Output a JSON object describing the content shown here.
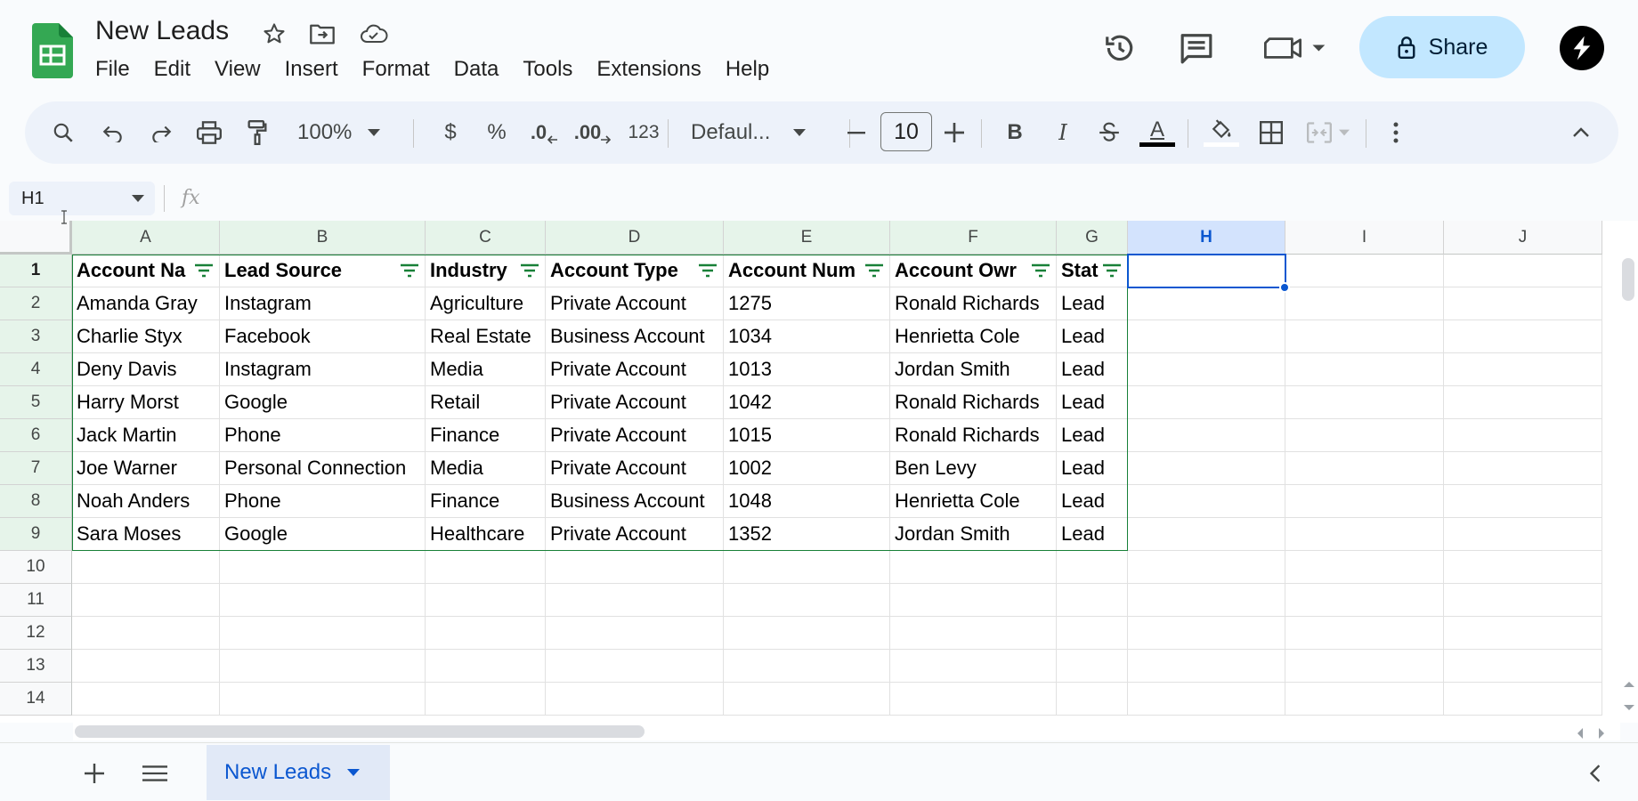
{
  "app": {
    "title": "New Leads",
    "menu": [
      "File",
      "Edit",
      "View",
      "Insert",
      "Format",
      "Data",
      "Tools",
      "Extensions",
      "Help"
    ],
    "share_label": "Share",
    "icons": {
      "star": "star-icon",
      "move": "move-to-folder-icon",
      "cloud": "cloud-saved-icon",
      "history": "version-history-icon",
      "comments": "comments-icon",
      "meet": "meet-icon"
    }
  },
  "toolbar": {
    "zoom": "100%",
    "currency": "$",
    "percent": "%",
    "decrease_decimal": ".0",
    "increase_decimal": ".00",
    "number_format": "123",
    "font": "Defaul...",
    "font_size": "10",
    "bold": "B",
    "italic": "I",
    "text_color_letter": "A",
    "text_color": "#000000"
  },
  "formula_bar": {
    "cell_ref": "H1",
    "fx": "fx",
    "value": ""
  },
  "sheet": {
    "columns": [
      "A",
      "B",
      "C",
      "D",
      "E",
      "F",
      "G",
      "H",
      "I",
      "J"
    ],
    "rows": [
      "1",
      "2",
      "3",
      "4",
      "5",
      "6",
      "7",
      "8",
      "9",
      "10",
      "11",
      "12",
      "13",
      "14"
    ],
    "header": [
      "Account Na",
      "Lead Source",
      "Industry",
      "Account Type",
      "Account Num",
      "Account Owr",
      "Stat"
    ],
    "data": [
      [
        "Amanda Gray",
        "Instagram",
        "Agriculture",
        "Private Account",
        "1275",
        "Ronald Richards",
        "Lead"
      ],
      [
        "Charlie Styx",
        "Facebook",
        "Real Estate",
        "Business Account",
        "1034",
        "Henrietta Cole",
        "Lead"
      ],
      [
        "Deny Davis",
        "Instagram",
        "Media",
        "Private Account",
        "1013",
        "Jordan Smith",
        "Lead"
      ],
      [
        "Harry Morst",
        "Google",
        "Retail",
        "Private Account",
        "1042",
        "Ronald Richards",
        "Lead"
      ],
      [
        "Jack Martin",
        "Phone",
        "Finance",
        "Private Account",
        "1015",
        "Ronald Richards",
        "Lead"
      ],
      [
        "Joe Warner",
        "Personal Connection",
        "Media",
        "Private Account",
        "1002",
        "Ben Levy",
        "Lead"
      ],
      [
        "Noah Anders",
        "Phone",
        "Finance",
        "Business Account",
        "1048",
        "Henrietta Cole",
        "Lead"
      ],
      [
        "Sara Moses",
        "Google",
        "Healthcare",
        "Private Account",
        "1352",
        "Jordan Smith",
        "Lead"
      ]
    ],
    "active_cell": "H1",
    "accent_color": "#0b57d0",
    "filter_color": "#188038"
  },
  "tabs": {
    "active": "New Leads"
  }
}
